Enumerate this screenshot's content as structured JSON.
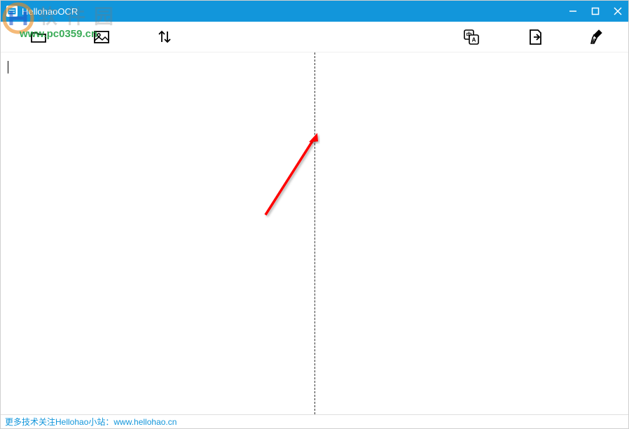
{
  "window": {
    "title": "HellohaoOCR"
  },
  "watermark": {
    "text": "软件园",
    "url": "www.pc0359.cn"
  },
  "statusbar": {
    "prefix": "更多技术关注Hellohao小站：",
    "link_text": "www.hellohao.cn",
    "link_url": "www.hellohao.cn"
  },
  "toolbar": {
    "open_folder": "open-folder",
    "open_image": "open-image",
    "sort": "sort",
    "translate": "translate",
    "export": "export",
    "clear": "clear"
  },
  "colors": {
    "primary": "#1296db",
    "arrow": "#ff0000",
    "watermark_green": "#1a9e3c"
  }
}
